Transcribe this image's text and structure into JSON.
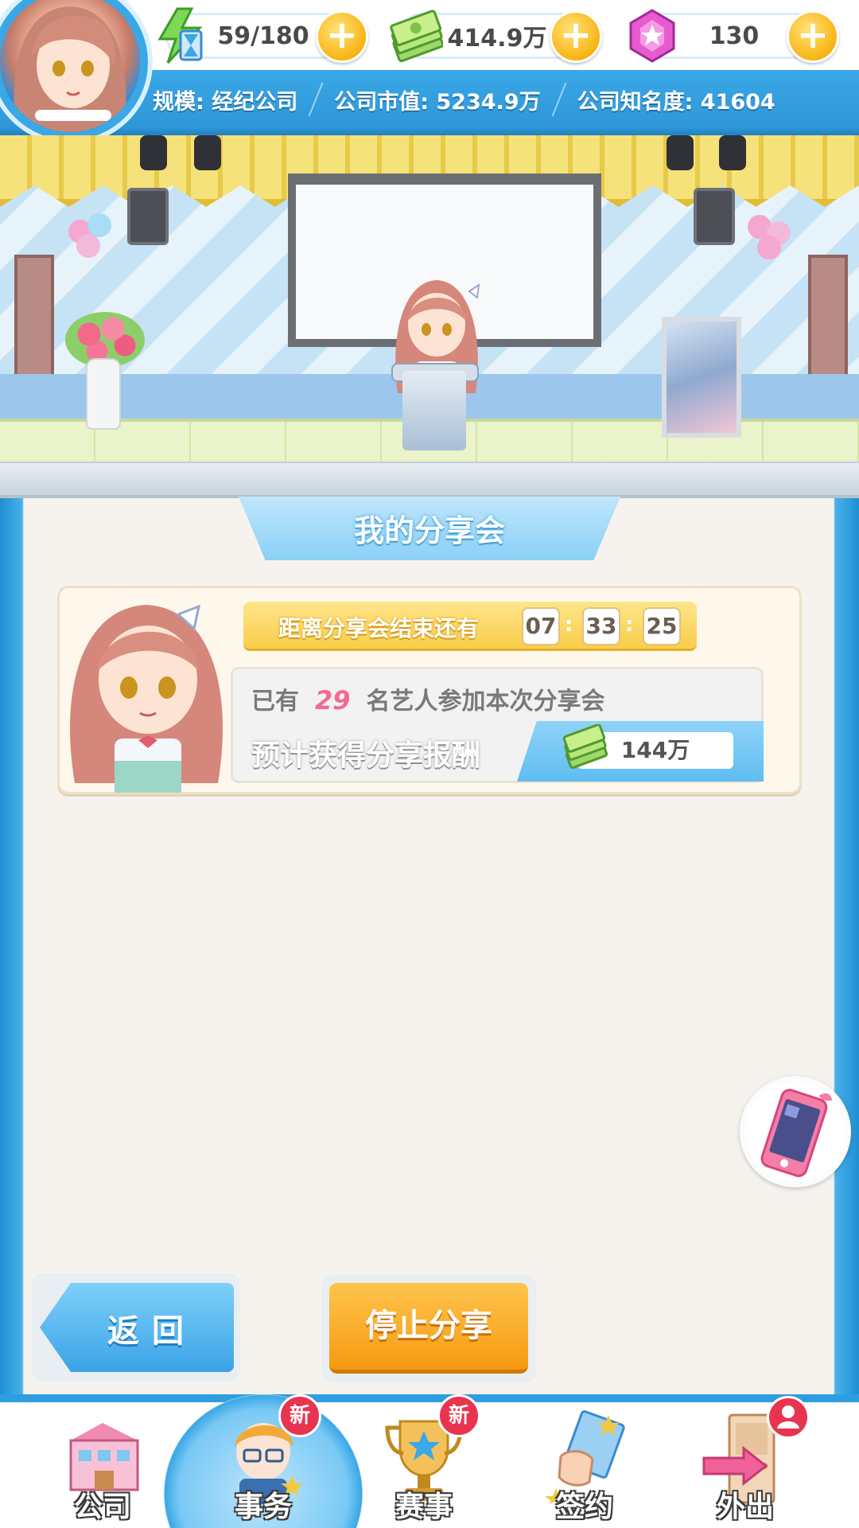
{
  "resources": {
    "stamina": "59/180",
    "money": "414.9万",
    "gems": "130"
  },
  "company": {
    "scale": "规模: 经纪公司",
    "market_value": "公司市值: 5234.9万",
    "fame": "公司知名度: 41604"
  },
  "panel": {
    "title": "我的分享会",
    "timer_label": "距离分享会结束还有",
    "timer": {
      "hours": "07",
      "minutes": "33",
      "seconds": "25"
    },
    "participants_prefix": "已有",
    "participants_count": "29",
    "participants_suffix": "名艺人参加本次分享会",
    "reward_label": "预计获得分享报酬",
    "reward_value": "144万"
  },
  "buttons": {
    "back": "返回",
    "stop": "停止分享"
  },
  "nav": [
    {
      "label": "公司",
      "badge": ""
    },
    {
      "label": "事务",
      "badge": "新"
    },
    {
      "label": "赛事",
      "badge": "新"
    },
    {
      "label": "签约",
      "badge": ""
    },
    {
      "label": "外出",
      "badge": "person"
    }
  ],
  "colors": {
    "primary_blue": "#3aa7e6",
    "accent_orange": "#f59a10",
    "accent_yellow": "#f8cd4a",
    "badge_red": "#e8344f",
    "highlight_pink": "#f36a8f"
  }
}
